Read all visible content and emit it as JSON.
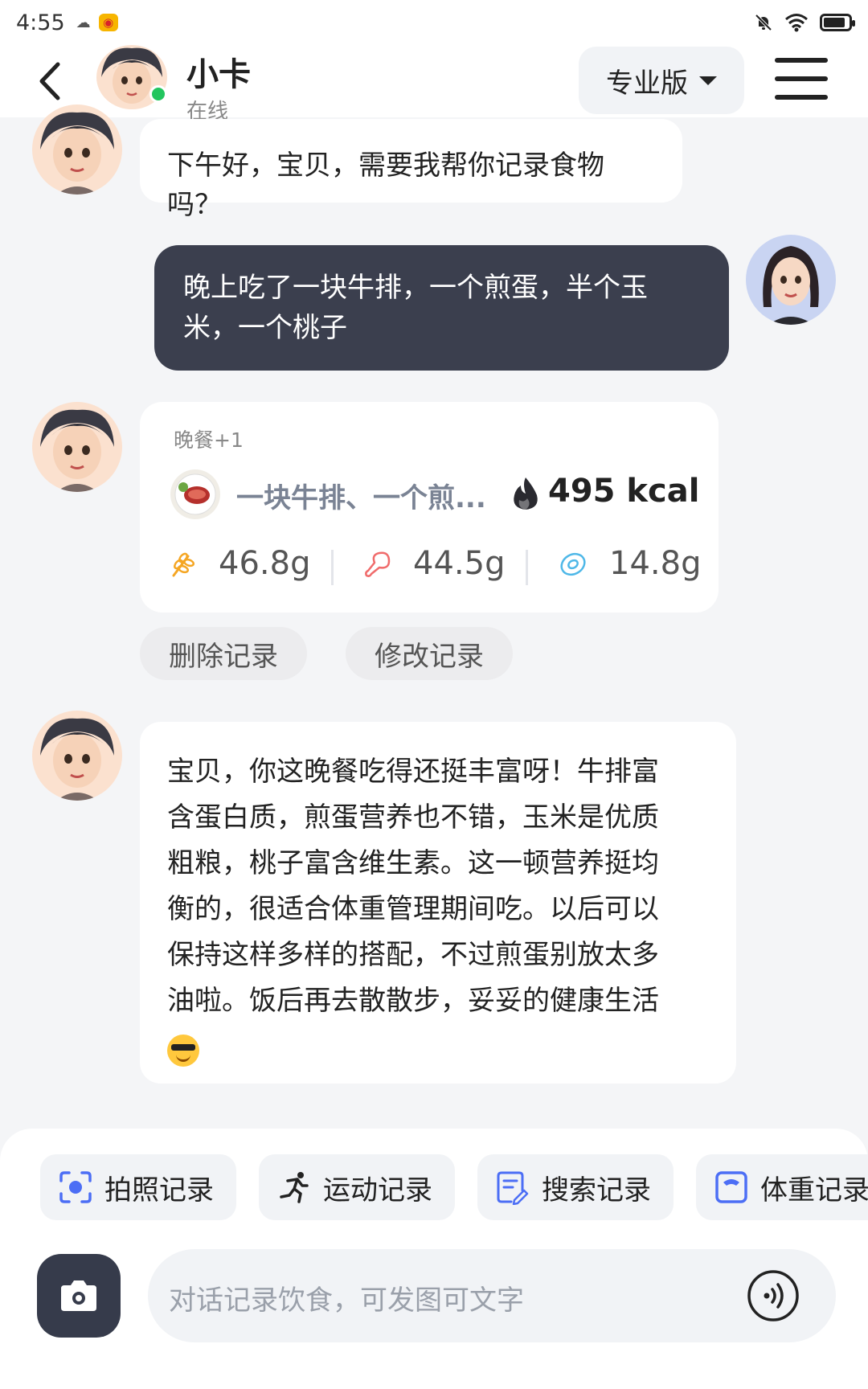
{
  "status_bar": {
    "time": "4:55"
  },
  "header": {
    "name": "小卡",
    "status": "在线",
    "plan_label": "专业版"
  },
  "messages": {
    "greeting": "下午好，宝贝，需要我帮你记录食物吗？",
    "user_line1": "晚上吃了一块牛排，一个煎蛋，半个玉",
    "user_line2": "米，一个桃子",
    "reply_lines": [
      "宝贝，你这晚餐吃得还挺丰富呀！牛排富",
      "含蛋白质，煎蛋营养也不错，玉米是优质",
      "粗粮，桃子富含维生素。这一顿营养挺均",
      "衡的，很适合体重管理期间吃。以后可以",
      "保持这样多样的搭配，不过煎蛋别放太多",
      "油啦。饭后再去散散步，妥妥的健康生活"
    ],
    "reply_emoji": "smiling-face-with-sunglasses"
  },
  "meal_card": {
    "tag": "晚餐+1",
    "food_name": "一块牛排、一个煎...",
    "kcal": "495 kcal",
    "carbs": "46.8g",
    "protein": "44.5g",
    "fat": "14.8g"
  },
  "card_actions": {
    "delete": "删除记录",
    "edit": "修改记录"
  },
  "quick_actions": {
    "photo": "拍照记录",
    "exercise": "运动记录",
    "search": "搜索记录",
    "weight": "体重记录"
  },
  "input": {
    "placeholder": "对话记录饮食，可发图可文字"
  },
  "colors": {
    "user_bubble": "#3b3f4e",
    "accent_blue": "#4c6ef5",
    "online": "#22c55e",
    "carbs": "#f5a623",
    "protein": "#f06b6b",
    "fat": "#4fb8e8"
  }
}
